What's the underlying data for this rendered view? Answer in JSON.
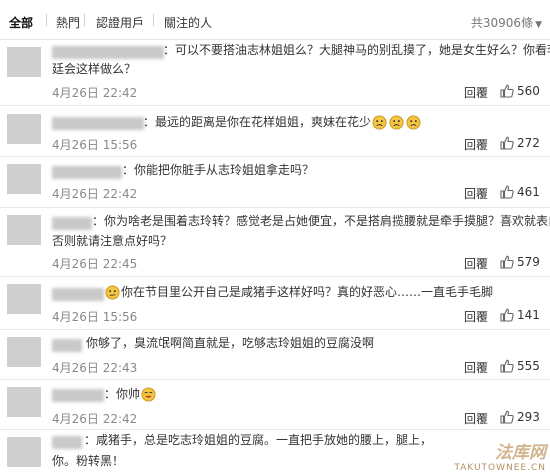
{
  "tabs": {
    "all": "全部",
    "hot": "熱門",
    "verified": "認證用戶",
    "following": "關注的人",
    "total": "共30906條"
  },
  "comments": [
    {
      "text": "：可以不要搭油志林姐姐么？大腿神马的别乱摸了，她是女生好么？你看李治",
      "text2": "廷会这样做么？",
      "time": "4月26日 22:42",
      "reply": "回覆",
      "likes": "560"
    },
    {
      "text": "：最远的距离是你在花样姐姐，爽妹在花少",
      "time": "4月26日 15:56",
      "reply": "回覆",
      "likes": "272"
    },
    {
      "text": "：你能把你脏手从志玲姐姐拿走吗？",
      "time": "4月26日 22:42",
      "reply": "回覆",
      "likes": "461"
    },
    {
      "text": "：你为啥老是围着志玲转？感觉老是占她便宜，不是搭肩揽腰就是牵手摸腿？喜欢就表白，",
      "text2": "否则就请注意点好吗？",
      "time": "4月26日 22:45",
      "reply": "回覆",
      "likes": "579"
    },
    {
      "text": "你在节目里公开自己是咸猪手这样好吗？真的好恶心……一直毛手毛脚",
      "time": "4月26日 15:56",
      "reply": "回覆",
      "likes": "141"
    },
    {
      "text": "你够了，臭流氓啊简直就是，吃够志玲姐姐的豆腐没啊",
      "time": "4月26日 22:43",
      "reply": "回覆",
      "likes": "555"
    },
    {
      "text": "：你帅",
      "time": "4月26日 22:42",
      "reply": "回覆",
      "likes": "293"
    },
    {
      "text": "：咸猪手，总是吃志玲姐姐的豆腐。一直把手放她的腰上，腿上，",
      "text2": "你。粉转黑！"
    }
  ],
  "watermark": {
    "title": "法库网",
    "url": "TAKUTOWNEE.CN"
  },
  "colors": {
    "divider": "#e8e8e8",
    "time": "#8a8a8a",
    "tab_active": "#111111"
  }
}
